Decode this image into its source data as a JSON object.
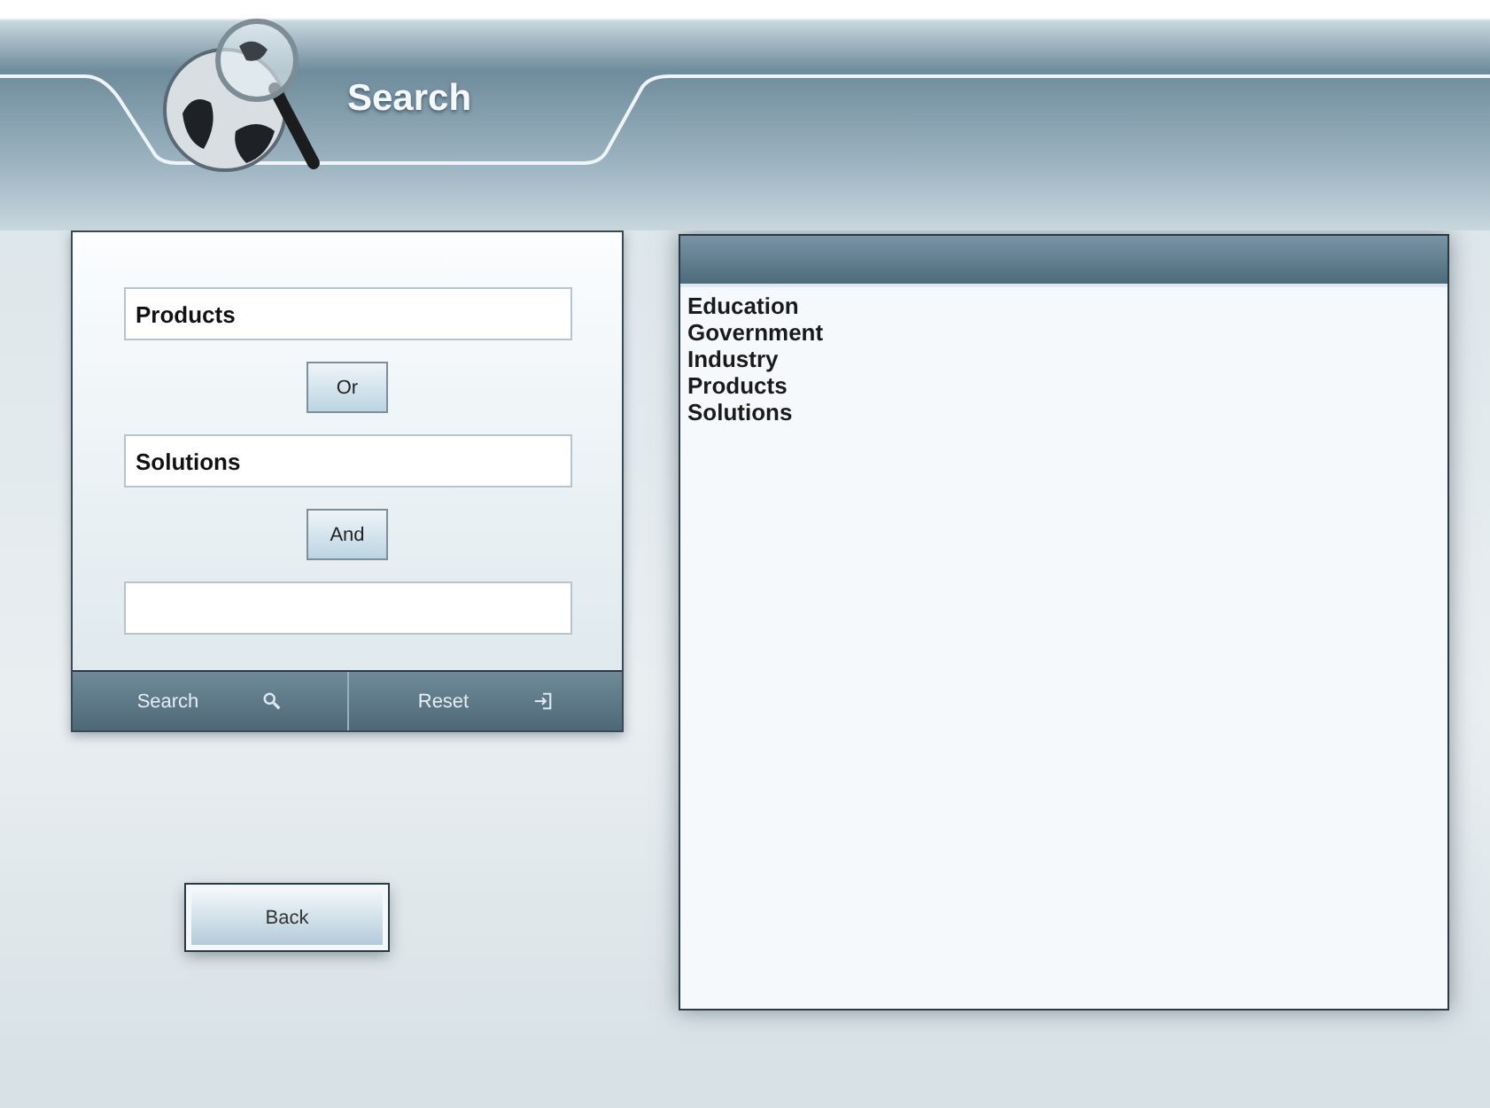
{
  "header": {
    "title": "Search"
  },
  "query": [
    {
      "kind": "field",
      "value": "Products"
    },
    {
      "kind": "operator",
      "label": "Or"
    },
    {
      "kind": "field",
      "value": "Solutions"
    },
    {
      "kind": "operator",
      "label": "And"
    },
    {
      "kind": "field"
    }
  ],
  "actions": [
    {
      "label": "Search",
      "kind": "search"
    },
    {
      "label": "Reset",
      "kind": "reset"
    }
  ],
  "results": {
    "items": [
      "Education",
      "Government",
      "Industry",
      "Products",
      "Solutions"
    ]
  },
  "back_button": "Back"
}
